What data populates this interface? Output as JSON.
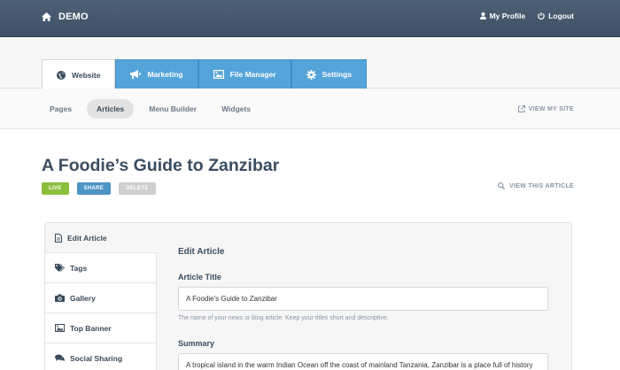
{
  "header": {
    "brand": "DEMO",
    "brand_icon": "home-icon",
    "my_profile": "My Profile",
    "logout": "Logout"
  },
  "tabs": [
    {
      "label": "Website",
      "icon": "globe-icon",
      "active": true
    },
    {
      "label": "Marketing",
      "icon": "bullhorn-icon",
      "active": false
    },
    {
      "label": "File Manager",
      "icon": "image-icon",
      "active": false
    },
    {
      "label": "Settings",
      "icon": "gear-icon",
      "active": false
    }
  ],
  "subnav": {
    "items": [
      "Pages",
      "Articles",
      "Menu Builder",
      "Widgets"
    ],
    "active": "Articles",
    "view_site": "VIEW MY SITE"
  },
  "article": {
    "title": "A Foodie’s Guide to Zanzibar",
    "badges": {
      "live": "LIVE",
      "share": "SHARE",
      "delete": "DELETE"
    },
    "view_article": "VIEW THIS ARTICLE"
  },
  "sidebar": {
    "items": [
      {
        "label": "Edit Article",
        "icon": "document-icon"
      },
      {
        "label": "Tags",
        "icon": "tags-icon"
      },
      {
        "label": "Gallery",
        "icon": "camera-icon"
      },
      {
        "label": "Top Banner",
        "icon": "picture-icon"
      },
      {
        "label": "Social Sharing",
        "icon": "comments-icon"
      }
    ]
  },
  "form": {
    "heading": "Edit Article",
    "title_label": "Article Title",
    "title_value": "A Foodie's Guide to Zanzibar",
    "title_help": "The name of your news or blog article. Keep your titles short and descriptive.",
    "summary_label": "Summary",
    "summary_value": "A tropical island in the warm Indian Ocean off the coast of mainland Tanzania, Zanzibar is a place full of history"
  },
  "colors": {
    "topbar": "#46586d",
    "tab_blue": "#55a4d9",
    "live": "#8bbf3d",
    "share": "#4c93c6",
    "delete": "#cfcfcf"
  }
}
